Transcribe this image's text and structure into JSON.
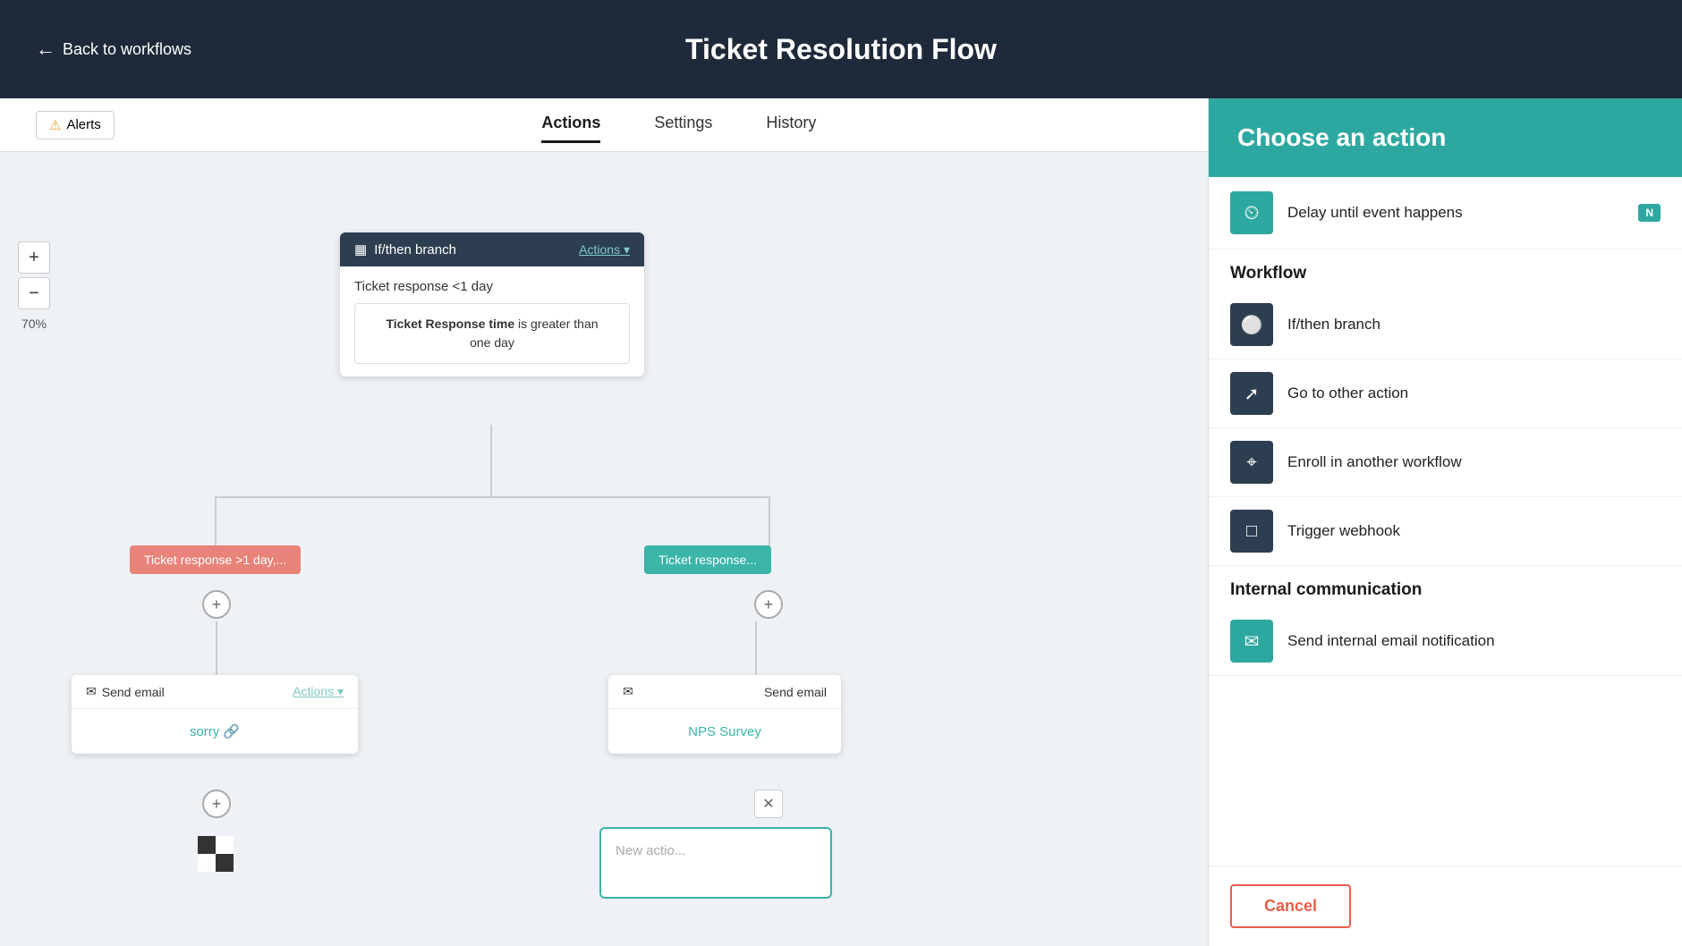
{
  "topBar": {
    "backLabel": "Back to workflows",
    "title": "Ticket Resolution Flow"
  },
  "tabs": {
    "items": [
      {
        "label": "Actions",
        "active": true
      },
      {
        "label": "Settings",
        "active": false
      },
      {
        "label": "History",
        "active": false
      }
    ]
  },
  "alerts": {
    "label": "Alerts"
  },
  "zoom": {
    "level": "70%",
    "plusLabel": "+",
    "minusLabel": "−"
  },
  "canvas": {
    "branchCard": {
      "title": "If/then branch",
      "actionsLabel": "Actions ▾",
      "branchLabel": "Ticket response <1 day",
      "condition": {
        "field": "Ticket Response time",
        "operator": "is greater than",
        "value": "one day"
      }
    },
    "redTag": "Ticket response >1 day,...",
    "tealTag": "Ticket response...",
    "emailCard1": {
      "header": "Send email",
      "actionsLabel": "Actions ▾",
      "link": "sorry 🔗"
    },
    "emailCard2": {
      "header": "Send email",
      "link": "NPS Survey"
    },
    "newAction": "New actio..."
  },
  "rightPanel": {
    "title": "Choose an action",
    "delayItem": {
      "label": "Delay until event happens",
      "badge": "N"
    },
    "sections": [
      {
        "heading": "Workflow",
        "items": [
          {
            "label": "If/then branch",
            "icon": "branch-icon"
          },
          {
            "label": "Go to other action",
            "icon": "goto-icon"
          },
          {
            "label": "Enroll in another workflow",
            "icon": "enroll-icon"
          },
          {
            "label": "Trigger webhook",
            "icon": "webhook-icon"
          }
        ]
      },
      {
        "heading": "Internal communication",
        "items": [
          {
            "label": "Send internal email notification",
            "icon": "email-icon",
            "teal": true
          }
        ]
      }
    ],
    "cancelLabel": "Cancel"
  }
}
